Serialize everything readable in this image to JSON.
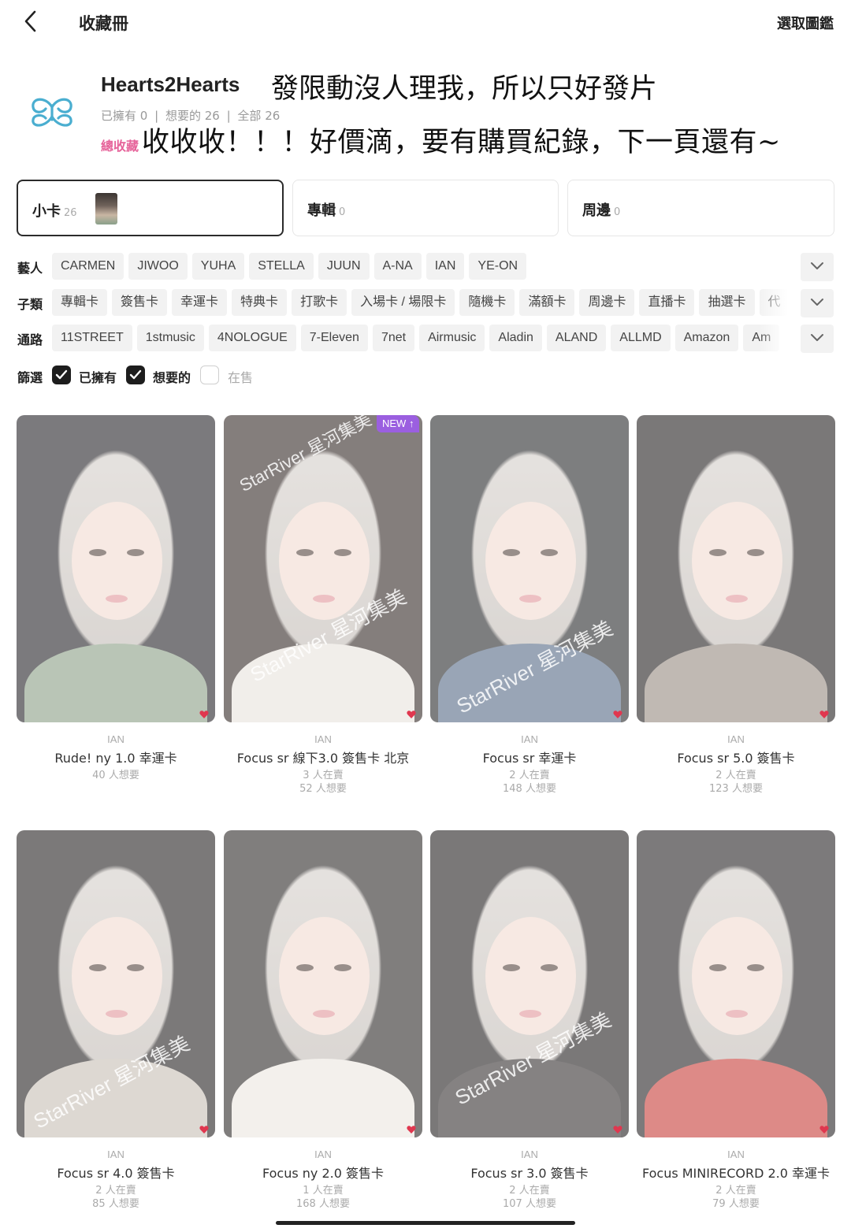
{
  "header": {
    "title": "收藏冊",
    "right_action": "選取圖鑑"
  },
  "group": {
    "name": "Hearts2Hearts",
    "owned": "已擁有 0",
    "wanted": "想要的 26",
    "all": "全部 26",
    "total_partial": "總收藏",
    "brand_color": "#4aaed0"
  },
  "overlay_text": {
    "line1": "發限動沒人理我，所以只好發片",
    "line2": "收收收！！！好價滴，要有購買紀錄，下一頁還有~"
  },
  "categories": [
    {
      "label": "小卡",
      "count": "26"
    },
    {
      "label": "專輯",
      "count": "0"
    },
    {
      "label": "周邊",
      "count": "0"
    }
  ],
  "filters": {
    "artist": {
      "label": "藝人",
      "chips": [
        "CARMEN",
        "JIWOO",
        "YUHA",
        "STELLA",
        "JUUN",
        "A-NA",
        "IAN",
        "YE-ON"
      ]
    },
    "subtype": {
      "label": "子類",
      "chips": [
        "專輯卡",
        "簽售卡",
        "幸運卡",
        "特典卡",
        "打歌卡",
        "入場卡 / 場限卡",
        "隨機卡",
        "滿額卡",
        "周邊卡",
        "直播卡",
        "抽選卡",
        "代"
      ]
    },
    "channel": {
      "label": "通路",
      "chips": [
        "11STREET",
        "1stmusic",
        "4NOLOGUE",
        "7-Eleven",
        "7net",
        "Airmusic",
        "Aladin",
        "ALAND",
        "ALLMD",
        "Amazon",
        "Am"
      ]
    },
    "screen": {
      "label": "篩選",
      "options": [
        {
          "label": "已擁有",
          "checked": true
        },
        {
          "label": "想要的",
          "checked": true
        },
        {
          "label": "在售",
          "checked": false
        }
      ]
    }
  },
  "cards": [
    {
      "member": "IAN",
      "title": "Rude! ny 1.0 幸運卡",
      "line1": "40 人想要",
      "line2": "",
      "is_new": false,
      "badge": ""
    },
    {
      "member": "IAN",
      "title": "Focus sr 線下3.0 簽售卡 北京",
      "line1": "3 人在賣",
      "line2": "52 人想要",
      "is_new": true,
      "badge": "NEW ↑"
    },
    {
      "member": "IAN",
      "title": "Focus sr 幸運卡",
      "line1": "2 人在賣",
      "line2": "148 人想要",
      "is_new": false,
      "badge": ""
    },
    {
      "member": "IAN",
      "title": "Focus sr 5.0 簽售卡",
      "line1": "2 人在賣",
      "line2": "123 人想要",
      "is_new": false,
      "badge": ""
    },
    {
      "member": "IAN",
      "title": "Focus sr 4.0 簽售卡",
      "line1": "2 人在賣",
      "line2": "85 人想要",
      "is_new": false,
      "badge": ""
    },
    {
      "member": "IAN",
      "title": "Focus ny 2.0 簽售卡",
      "line1": "1 人在賣",
      "line2": "168 人想要",
      "is_new": false,
      "badge": ""
    },
    {
      "member": "IAN",
      "title": "Focus sr 3.0 簽售卡",
      "line1": "2 人在賣",
      "line2": "107 人想要",
      "is_new": false,
      "badge": ""
    },
    {
      "member": "IAN",
      "title": "Focus MINIRECORD 2.0 幸運卡",
      "line1": "2 人在賣",
      "line2": "79 人想要",
      "is_new": false,
      "badge": ""
    }
  ],
  "watermark": "StarRiver 星河集美",
  "colors": {
    "wanted_heart": "#e0374f",
    "new_badge": "#9b5fe0",
    "total_pink": "#e6639a"
  }
}
